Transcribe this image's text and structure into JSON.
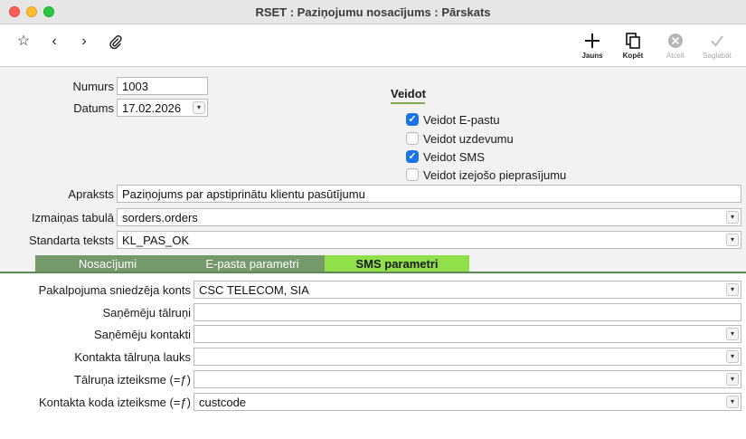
{
  "window": {
    "title": "RSET : Paziņojumu nosacījums : Pārskats"
  },
  "toolbar": {
    "left_icons": [
      "star-icon",
      "chevron-left-icon",
      "chevron-right-icon",
      "paperclip-icon"
    ],
    "new_label": "Jauns",
    "copy_label": "Kopēt",
    "cancel_label": "Atcelt",
    "save_label": "Saglabāt"
  },
  "form": {
    "number_label": "Numurs",
    "number_value": "1003",
    "date_label": "Datums",
    "date_value": "17.02.2026",
    "create_title": "Veidot",
    "create_options": [
      {
        "label": "Veidot E-pastu",
        "checked": true
      },
      {
        "label": "Veidot uzdevumu",
        "checked": false
      },
      {
        "label": "Veidot SMS",
        "checked": true
      },
      {
        "label": "Veidot izejošo pieprasījumu",
        "checked": false
      }
    ],
    "description_label": "Apraksts",
    "description_value": "Paziņojums par apstiprinātu klientu pasūtījumu",
    "change_table_label": "Izmaiņas tabulā",
    "change_table_value": "sorders.orders",
    "standard_text_label": "Standarta teksts",
    "standard_text_value": "KL_PAS_OK"
  },
  "tabs": {
    "conditions": "Nosacījumi",
    "email_params": "E-pasta parametri",
    "sms_params": "SMS parametri",
    "active": "sms_params"
  },
  "sms": {
    "provider_label": "Pakalpojuma sniedzēja konts",
    "provider_value": "CSC TELECOM, SIA",
    "recipient_phones_label": "Saņēmēju tālruņi",
    "recipient_phones_value": "",
    "recipient_contacts_label": "Saņēmēju kontakti",
    "recipient_contacts_value": "",
    "contact_phone_field_label": "Kontakta tālruņa lauks",
    "contact_phone_field_value": "",
    "phone_expr_label": "Tālruņa izteiksme (=ƒ)",
    "phone_expr_value": "",
    "contact_code_expr_label": "Kontakta koda izteiksme (=ƒ)",
    "contact_code_expr_value": "custcode"
  },
  "colors": {
    "tab_active": "#8fe04a",
    "tab_inactive": "#75996b",
    "divider": "#5f8a55",
    "checkbox_checked": "#1a73e8"
  }
}
